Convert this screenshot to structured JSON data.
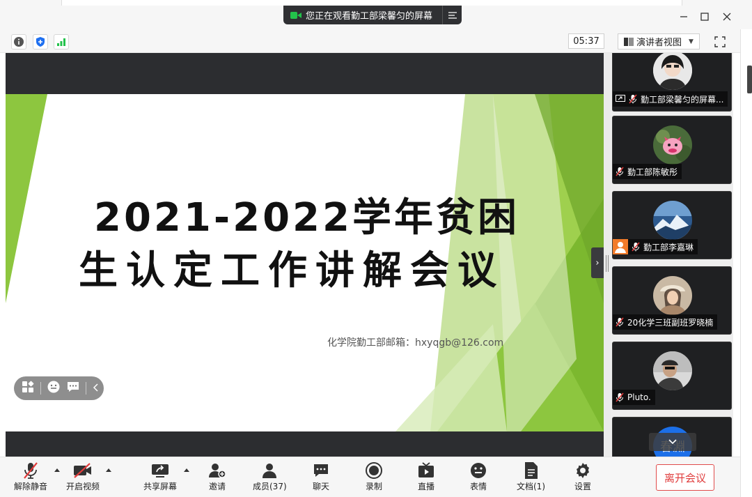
{
  "banner": {
    "text": "您正在观看勤工部梁馨匀的屏幕"
  },
  "infobar": {
    "timer": "05:37",
    "view_label": "演讲者视图"
  },
  "slide": {
    "title_line1": "2021-2022学年贫困",
    "title_line2": "生认定工作讲解会议",
    "email": "化学院勤工部邮箱：hxyqgb@126.com"
  },
  "participants": [
    {
      "name": "勤工部梁馨匀的屏幕..."
    },
    {
      "name": "勤工部陈敏彤"
    },
    {
      "name": "勤工部李嘉琳"
    },
    {
      "name": "20化学三班副班罗晓楠"
    },
    {
      "name": "Pluto."
    },
    {
      "name": "春淵"
    }
  ],
  "toolbar": {
    "unmute": "解除静音",
    "start_video": "开启视频",
    "share_screen": "共享屏幕",
    "invite": "邀请",
    "members": "成员(37)",
    "chat": "聊天",
    "record": "录制",
    "live": "直播",
    "reactions": "表情",
    "docs": "文档(1)",
    "settings": "设置",
    "leave": "离开会议"
  },
  "colors": {
    "accent_green": "#8dc63f",
    "leave_red": "#e03c3c",
    "status_green": "#23c24b"
  }
}
